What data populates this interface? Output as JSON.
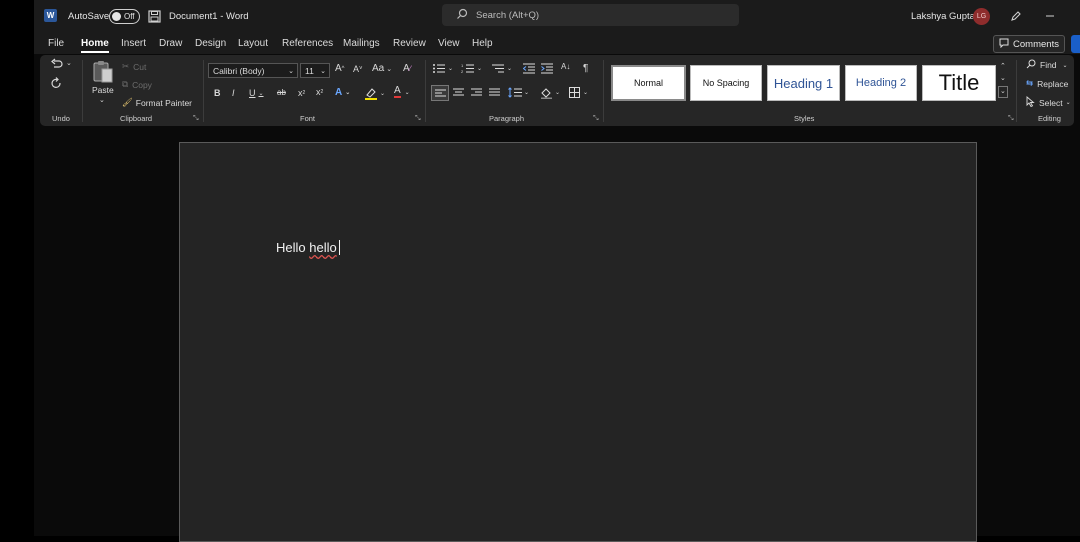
{
  "titlebar": {
    "autosave_label": "AutoSave",
    "autosave_state": "Off",
    "document_title": "Document1 - Word",
    "search_placeholder": "Search (Alt+Q)",
    "user_name": "Lakshya Gupta",
    "user_initials": "LG"
  },
  "menu": {
    "tabs": [
      "File",
      "Home",
      "Insert",
      "Draw",
      "Design",
      "Layout",
      "References",
      "Mailings",
      "Review",
      "View",
      "Help"
    ],
    "active": "Home",
    "comments_label": "Comments"
  },
  "ribbon": {
    "undo_label": "Undo",
    "clipboard": {
      "paste": "Paste",
      "cut": "Cut",
      "copy": "Copy",
      "format_painter": "Format Painter",
      "group": "Clipboard"
    },
    "font": {
      "family": "Calibri (Body)",
      "size": "11",
      "group": "Font"
    },
    "paragraph_group": "Paragraph",
    "styles": {
      "items": [
        "Normal",
        "No Spacing",
        "Heading 1",
        "Heading 2",
        "Title"
      ],
      "group": "Styles"
    },
    "editing": {
      "find": "Find",
      "replace": "Replace",
      "select": "Select",
      "group": "Editing"
    }
  },
  "document": {
    "text_first": "Hello",
    "text_second": "hello"
  },
  "colors": {
    "word_blue": "#2b579a",
    "ribbon_bg": "#262626",
    "page_bg": "#242424",
    "highlight_yellow": "#f2e000",
    "font_color_red": "#e03a3a",
    "avatar_bg": "#8e2c2c"
  }
}
